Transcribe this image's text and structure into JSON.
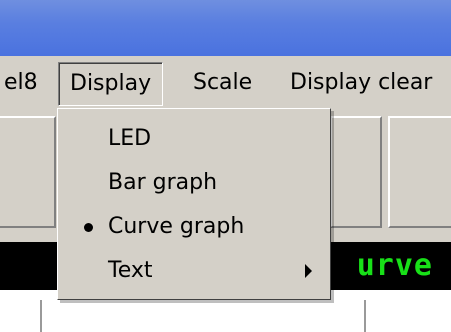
{
  "menubar": {
    "items": [
      "el8",
      "Display",
      "Scale",
      "Display clear"
    ],
    "active": "Display"
  },
  "display": {
    "text": "urve",
    "text_color": "#18e018",
    "background": "#000000"
  },
  "dropdown": {
    "items": [
      {
        "label": "LED",
        "selected": false,
        "has_submenu": false
      },
      {
        "label": "Bar graph",
        "selected": false,
        "has_submenu": false
      },
      {
        "label": "Curve graph",
        "selected": true,
        "has_submenu": false
      },
      {
        "label": "Text",
        "selected": false,
        "has_submenu": true
      }
    ]
  },
  "colors": {
    "titlebar": "#5a7fe0",
    "window_face": "#d4d0c8"
  }
}
